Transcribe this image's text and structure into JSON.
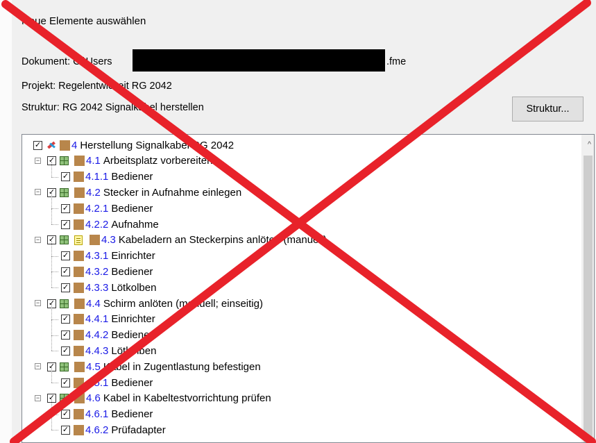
{
  "dialog": {
    "title": "Neue Elemente auswählen",
    "document_prefix": "Dokument: C:\\Users",
    "document_suffix": ".fme",
    "project": "Projekt: Regelentwickeit RG 2042",
    "structure": "Struktur: RG 2042 Signalkabel herstellen",
    "structure_button": "Struktur..."
  },
  "tree": {
    "root": {
      "num": "4",
      "label": "Herstellung Signalkabel RG 2042"
    },
    "items": [
      {
        "num": "4.1",
        "label": "Arbeitsplatz vorbereiten",
        "level": 1
      },
      {
        "num": "4.1.1",
        "label": "Bediener",
        "level": 2
      },
      {
        "num": "4.2",
        "label": "Stecker in Aufnahme einlegen",
        "level": 1
      },
      {
        "num": "4.2.1",
        "label": "Bediener",
        "level": 2
      },
      {
        "num": "4.2.2",
        "label": "Aufnahme",
        "level": 2
      },
      {
        "num": "4.3",
        "label": "Kabeladern an Steckerpins anlöten (manuell)",
        "level": 1
      },
      {
        "num": "4.3.1",
        "label": "Einrichter",
        "level": 2
      },
      {
        "num": "4.3.2",
        "label": "Bediener",
        "level": 2
      },
      {
        "num": "4.3.3",
        "label": "Lötkolben",
        "level": 2
      },
      {
        "num": "4.4",
        "label": "Schirm anlöten (manuell; einseitig)",
        "level": 1
      },
      {
        "num": "4.4.1",
        "label": "Einrichter",
        "level": 2
      },
      {
        "num": "4.4.2",
        "label": "Bediener",
        "level": 2
      },
      {
        "num": "4.4.3",
        "label": "Lötkolben",
        "level": 2
      },
      {
        "num": "4.5",
        "label": "Kabel in Zugentlastung befestigen",
        "level": 1
      },
      {
        "num": "4.5.1",
        "label": "Bediener",
        "level": 2
      },
      {
        "num": "4.6",
        "label": "Kabel in Kabeltestvorrichtung prüfen",
        "level": 1
      },
      {
        "num": "4.6.1",
        "label": "Bediener",
        "level": 2
      },
      {
        "num": "4.6.2",
        "label": "Prüfadapter",
        "level": 2
      }
    ]
  },
  "icons": {
    "check": "✓",
    "expander": "−",
    "scroll_up": "^"
  },
  "colors": {
    "cross": "#e8222a",
    "number": "#1a1ae6",
    "element_square": "#b8864b"
  }
}
